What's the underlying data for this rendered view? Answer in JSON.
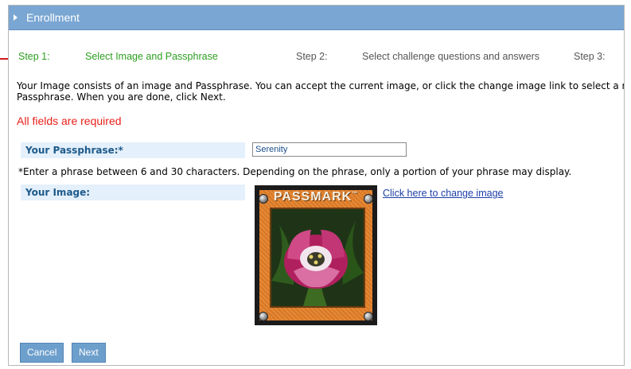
{
  "header": {
    "title": "Enrollment"
  },
  "steps": [
    {
      "label": "Step 1:",
      "text": "Select Image and Passphrase"
    },
    {
      "label": "Step 2:",
      "text": "Select challenge questions and answers"
    },
    {
      "label": "Step 3:"
    }
  ],
  "description": "Your Image consists of an image and Passphrase. You can accept the current image, or click the change image link to select a new\nPassphrase. When you are done, click Next.",
  "required_notice": "All fields are required",
  "form": {
    "passphrase_label": "Your Passphrase:*",
    "passphrase_value": "Serenity",
    "passphrase_hint": "*Enter a phrase between 6 and 30 characters. Depending on the phrase, only a portion of your phrase may display.",
    "image_label": "Your Image:",
    "change_image_link": "Click here to change image",
    "image_brand": "PASSMARK",
    "image_brand_mark": "™"
  },
  "buttons": {
    "cancel": "Cancel",
    "next": "Next"
  },
  "colors": {
    "header_bg": "#7aa6d3",
    "step_active": "#2c9e1f",
    "required": "#e8201a",
    "label_bg": "#e4f0fb",
    "button_bg": "#6d9fcc",
    "arrow": "#d4171b"
  }
}
